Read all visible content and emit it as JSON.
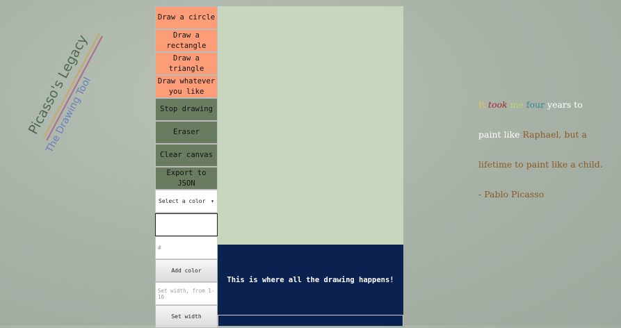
{
  "logo": {
    "title": "Picasso's Legacy",
    "subtitle": "The Drawing Tool"
  },
  "toolbar": {
    "draw_circle": "Draw a circle",
    "draw_rectangle": "Draw a rectangle",
    "draw_triangle": "Draw a triangle",
    "draw_freehand": "Draw whatever you like",
    "stop_drawing": "Stop drawing",
    "eraser": "Eraser",
    "clear_canvas": "Clear canvas",
    "export_json": "Export to JSON",
    "color_select": "Select a color",
    "hex_placeholder": "#",
    "add_color": "Add color",
    "width_placeholder": "Set width, from 1-10",
    "set_width": "Set width"
  },
  "info": {
    "message": "This is where all the drawing happens!"
  },
  "quote": {
    "w1": "It",
    "w2": "took",
    "w3": "me",
    "w4": "four",
    "w5": "years to",
    "line2a": "paint like",
    "line2b": "Raphael, but a",
    "line3": "lifetime to paint like a child.",
    "author": "- Pablo Picasso"
  },
  "colors": {
    "salmon_button": "#fc9d78",
    "dark_button": "#697c60",
    "canvas": "#c8d6bd",
    "info_panel": "#0b2150"
  }
}
